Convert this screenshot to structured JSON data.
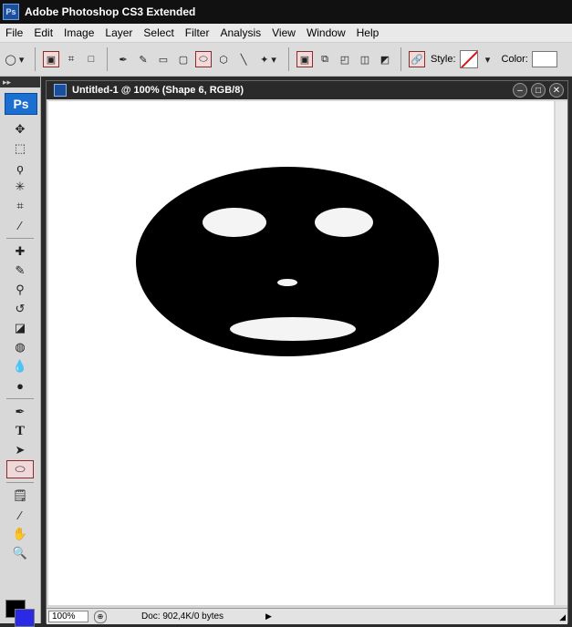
{
  "app": {
    "title": "Adobe Photoshop CS3 Extended",
    "badge": "Ps"
  },
  "menu": [
    "File",
    "Edit",
    "Image",
    "Layer",
    "Select",
    "Filter",
    "Analysis",
    "View",
    "Window",
    "Help"
  ],
  "options_bar": {
    "style_label": "Style:",
    "color_label": "Color:",
    "color_value": "#ffffff"
  },
  "toolbox": {
    "logo": "Ps",
    "foreground_color": "#000000",
    "background_color": "#2929e6"
  },
  "document": {
    "title": "Untitled-1 @ 100% (Shape 6, RGB/8)",
    "zoom": "100%",
    "doc_info": "Doc: 902,4K/0 bytes"
  },
  "canvas_content": {
    "face": "black-ellipse",
    "features": [
      "left-eye",
      "right-eye",
      "nose",
      "mouth"
    ]
  }
}
